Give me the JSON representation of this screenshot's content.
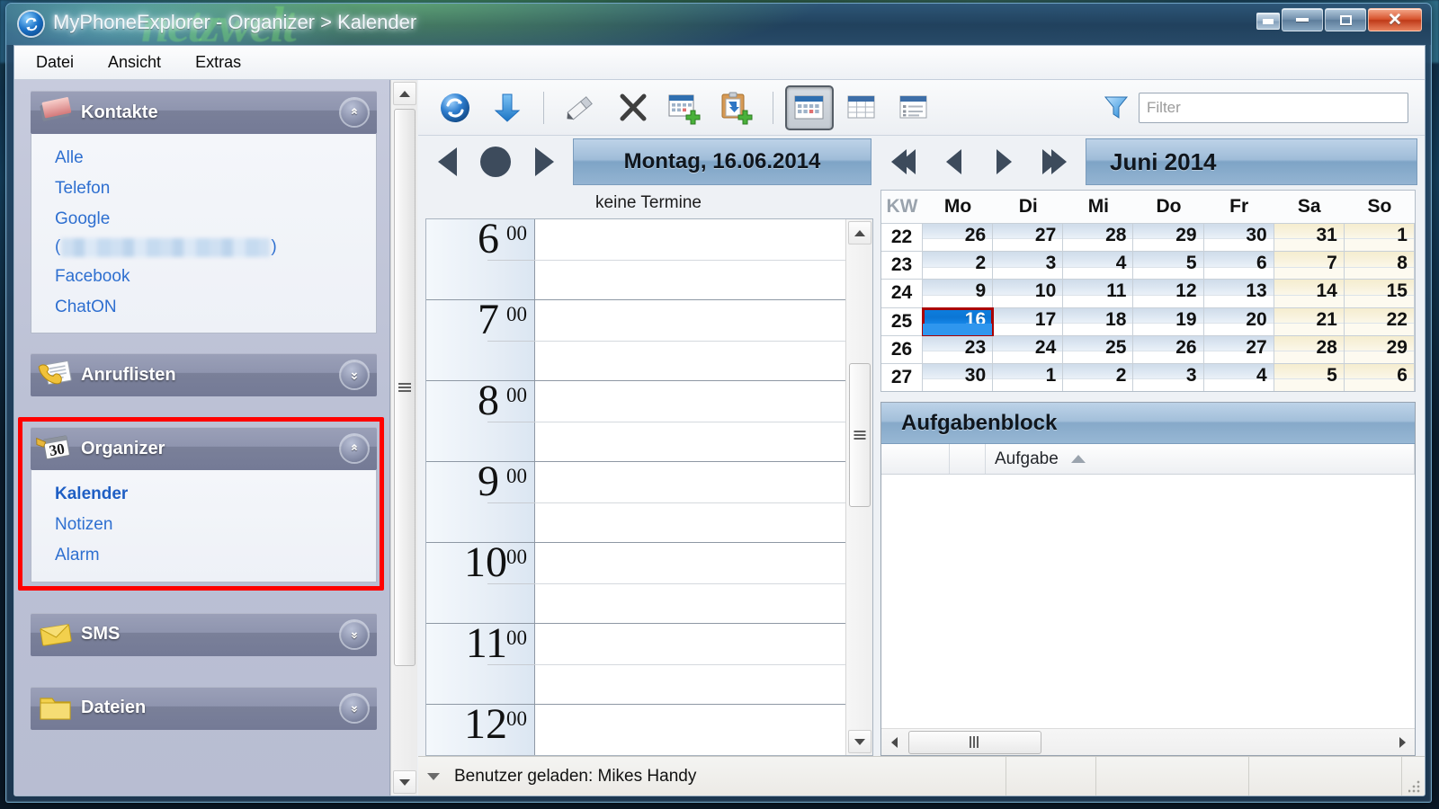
{
  "window": {
    "title": "MyPhoneExplorer - Organizer > Kalender",
    "app_icon": "sync-globe-icon",
    "controls": {
      "restore_small": "restore-small",
      "minimize": "minimize",
      "maximize": "maximize",
      "close": "close"
    }
  },
  "menu": {
    "items": [
      {
        "label": "Datei"
      },
      {
        "label": "Ansicht"
      },
      {
        "label": "Extras"
      }
    ]
  },
  "sidebar": {
    "panels": [
      {
        "title": "Kontakte",
        "icon": "address-book-icon",
        "expanded": true,
        "chevron": "chevron-up-double-icon",
        "links": [
          {
            "label": "Alle",
            "active": false
          },
          {
            "label": "Telefon",
            "active": false
          },
          {
            "label": "Google",
            "active": false
          },
          {
            "label": "(",
            "redacted": true,
            "label_end": ")"
          },
          {
            "label": "Facebook",
            "active": false
          },
          {
            "label": "ChatON",
            "active": false
          }
        ]
      },
      {
        "title": "Anruflisten",
        "icon": "call-list-icon",
        "expanded": false,
        "chevron": "chevron-down-double-icon",
        "links": []
      },
      {
        "title": "Organizer",
        "icon": "calendar-30-icon",
        "expanded": true,
        "highlighted": true,
        "chevron": "chevron-up-double-icon",
        "links": [
          {
            "label": "Kalender",
            "active": true
          },
          {
            "label": "Notizen",
            "active": false
          },
          {
            "label": "Alarm",
            "active": false
          }
        ]
      },
      {
        "title": "SMS",
        "icon": "envelope-icon",
        "expanded": false,
        "chevron": "chevron-down-double-icon",
        "links": []
      },
      {
        "title": "Dateien",
        "icon": "folder-icon",
        "expanded": false,
        "chevron": "chevron-down-double-icon",
        "links": []
      }
    ]
  },
  "toolbar": {
    "buttons": [
      {
        "name": "sync-button",
        "icon": "sync-refresh-icon"
      },
      {
        "name": "download-button",
        "icon": "download-arrow-icon"
      },
      {
        "name": "edit-button",
        "icon": "pencil-edit-icon"
      },
      {
        "name": "delete-button",
        "icon": "delete-x-icon"
      },
      {
        "name": "new-appointment-button",
        "icon": "calendar-add-icon"
      },
      {
        "name": "new-task-button",
        "icon": "clipboard-add-icon"
      },
      {
        "name": "day-view-button",
        "icon": "calendar-day-view-icon",
        "pressed": true
      },
      {
        "name": "month-view-button",
        "icon": "calendar-grid-view-icon",
        "pressed": false
      },
      {
        "name": "list-view-button",
        "icon": "list-view-icon",
        "pressed": false
      }
    ],
    "filter": {
      "icon": "filter-funnel-icon",
      "placeholder": "Filter",
      "value": ""
    }
  },
  "day_view": {
    "prev_label": "prev-day",
    "today_label": "today",
    "next_label": "next-day",
    "title": "Montag, 16.06.2014",
    "appointments_status": "keine Termine",
    "hours": [
      {
        "hour": "6",
        "minutes": "00"
      },
      {
        "hour": "7",
        "minutes": "00"
      },
      {
        "hour": "8",
        "minutes": "00"
      },
      {
        "hour": "9",
        "minutes": "00"
      },
      {
        "hour": "10",
        "minutes": "00"
      },
      {
        "hour": "11",
        "minutes": "00"
      },
      {
        "hour": "12",
        "minutes": "00"
      }
    ]
  },
  "month_view": {
    "title": "Juni 2014",
    "nav": {
      "prev_year": "prev-year",
      "prev_month": "prev-month",
      "next_month": "next-month",
      "next_year": "next-year"
    },
    "headers": [
      "KW",
      "Mo",
      "Di",
      "Mi",
      "Do",
      "Fr",
      "Sa",
      "So"
    ],
    "weeks": [
      {
        "kw": "22",
        "days": [
          {
            "d": "26",
            "other": true
          },
          {
            "d": "27",
            "other": true
          },
          {
            "d": "28",
            "other": true
          },
          {
            "d": "29",
            "other": true
          },
          {
            "d": "30",
            "other": true
          },
          {
            "d": "31",
            "other": true,
            "weekend": true
          },
          {
            "d": "1",
            "weekend": true
          }
        ]
      },
      {
        "kw": "23",
        "days": [
          {
            "d": "2"
          },
          {
            "d": "3"
          },
          {
            "d": "4"
          },
          {
            "d": "5"
          },
          {
            "d": "6"
          },
          {
            "d": "7",
            "weekend": true
          },
          {
            "d": "8",
            "weekend": true
          }
        ]
      },
      {
        "kw": "24",
        "days": [
          {
            "d": "9"
          },
          {
            "d": "10"
          },
          {
            "d": "11"
          },
          {
            "d": "12"
          },
          {
            "d": "13"
          },
          {
            "d": "14",
            "weekend": true
          },
          {
            "d": "15",
            "weekend": true
          }
        ]
      },
      {
        "kw": "25",
        "days": [
          {
            "d": "16",
            "selected": true
          },
          {
            "d": "17"
          },
          {
            "d": "18"
          },
          {
            "d": "19"
          },
          {
            "d": "20"
          },
          {
            "d": "21",
            "weekend": true
          },
          {
            "d": "22",
            "weekend": true
          }
        ]
      },
      {
        "kw": "26",
        "days": [
          {
            "d": "23"
          },
          {
            "d": "24"
          },
          {
            "d": "25"
          },
          {
            "d": "26"
          },
          {
            "d": "27"
          },
          {
            "d": "28",
            "weekend": true
          },
          {
            "d": "29",
            "weekend": true
          }
        ]
      },
      {
        "kw": "27",
        "days": [
          {
            "d": "30"
          },
          {
            "d": "1",
            "other": true
          },
          {
            "d": "2",
            "other": true
          },
          {
            "d": "3",
            "other": true
          },
          {
            "d": "4",
            "other": true
          },
          {
            "d": "5",
            "other": true,
            "weekend": true
          },
          {
            "d": "6",
            "other": true,
            "weekend": true
          }
        ]
      }
    ]
  },
  "tasks": {
    "title": "Aufgabenblock",
    "columns": [
      "",
      "",
      "Aufgabe"
    ],
    "sort_column": "Aufgabe",
    "sort_direction": "ascending",
    "rows": []
  },
  "statusbar": {
    "text": "Benutzer geladen: Mikes Handy",
    "collapse_icon": "chevron-down-icon",
    "resize_grip": "resize-grip-icon"
  },
  "colors": {
    "accent_blue": "#0d7fe0",
    "selection_border": "#aa0000",
    "highlight_box": "#ff0000",
    "link_blue": "#2e6fd0",
    "weekend_bg": "#fdfaf0",
    "title_gradient": "#9fbcd8"
  }
}
